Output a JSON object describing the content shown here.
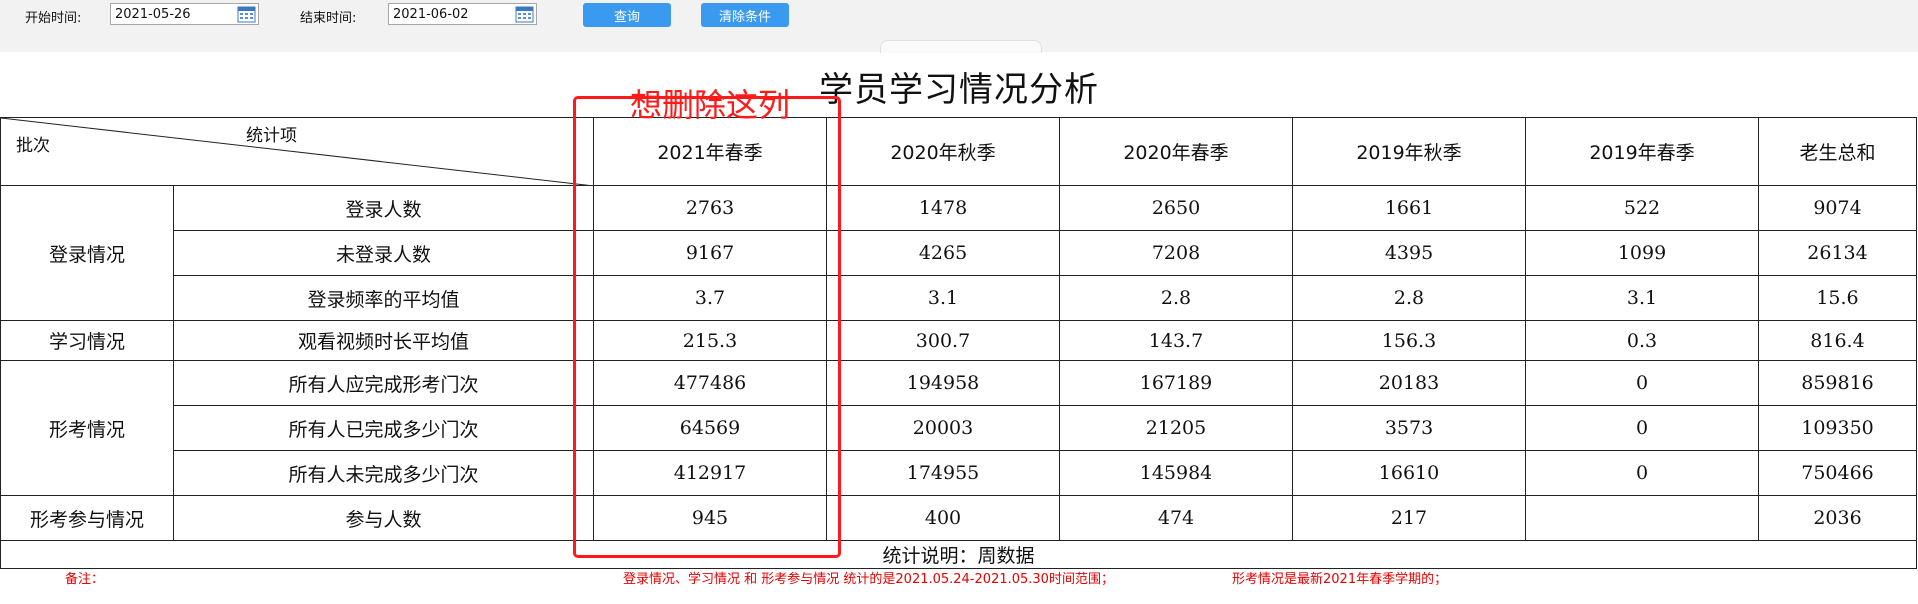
{
  "filters": {
    "start_label": "开始时间:",
    "start_value": "2021-05-26",
    "end_label": "结束时间:",
    "end_value": "2021-06-02",
    "query_button": "查询",
    "clear_button": "清除条件"
  },
  "report": {
    "title": "学员学习情况分析",
    "header": {
      "corner_top": "统计项",
      "corner_bottom": "批次",
      "columns": [
        "2021年春季",
        "2020年秋季",
        "2020年春季",
        "2019年秋季",
        "2019年春季",
        "老生总和"
      ]
    },
    "groups": {
      "login": "登录情况",
      "study": "学习情况",
      "exam": "形考情况",
      "exam_participation": "形考参与情况"
    },
    "rows": [
      {
        "label": "登录人数",
        "values": [
          "2763",
          "1478",
          "2650",
          "1661",
          "522",
          "9074"
        ]
      },
      {
        "label": "未登录人数",
        "values": [
          "9167",
          "4265",
          "7208",
          "4395",
          "1099",
          "26134"
        ]
      },
      {
        "label": "登录频率的平均值",
        "values": [
          "3.7",
          "3.1",
          "2.8",
          "2.8",
          "3.1",
          "15.6"
        ]
      },
      {
        "label": "观看视频时长平均值",
        "values": [
          "215.3",
          "300.7",
          "143.7",
          "156.3",
          "0.3",
          "816.4"
        ]
      },
      {
        "label": "所有人应完成形考门次",
        "values": [
          "477486",
          "194958",
          "167189",
          "20183",
          "0",
          "859816"
        ]
      },
      {
        "label": "所有人已完成多少门次",
        "values": [
          "64569",
          "20003",
          "21205",
          "3573",
          "0",
          "109350"
        ]
      },
      {
        "label": "所有人未完成多少门次",
        "values": [
          "412917",
          "174955",
          "145984",
          "16610",
          "0",
          "750466"
        ]
      },
      {
        "label": "参与人数",
        "values": [
          "945",
          "400",
          "474",
          "217",
          "",
          "2036"
        ]
      }
    ],
    "stat_note": "统计说明：周数据"
  },
  "remarks": {
    "label": "备注：",
    "text1": "登录情况、学习情况 和 形考参与情况 统计的是2021.05.24-2021.05.30时间范围；",
    "text2": "形考情况是最新2021年春季学期的；"
  },
  "annotation": {
    "text": "想删除这列",
    "color": "#ff1a1a"
  },
  "colors": {
    "button": "#3a9af0",
    "remark": "#e60000",
    "filter_bg": "#f2f2f2"
  }
}
